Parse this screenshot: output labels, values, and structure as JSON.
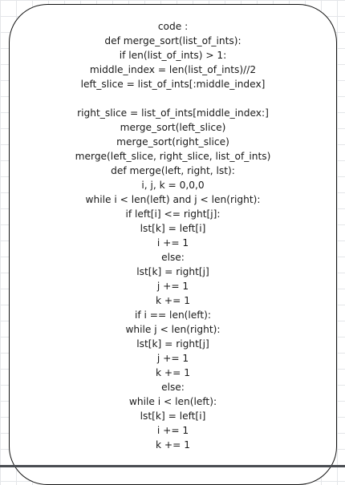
{
  "code_block": {
    "lines": [
      "code :",
      "def merge_sort(list_of_ints):",
      "if len(list_of_ints) > 1:",
      "middle_index = len(list_of_ints)//2",
      "left_slice = list_of_ints[:middle_index]",
      "",
      "right_slice = list_of_ints[middle_index:]",
      "merge_sort(left_slice)",
      "merge_sort(right_slice)",
      "merge(left_slice, right_slice, list_of_ints)",
      "def merge(left, right, lst):",
      "i, j, k = 0,0,0",
      "while i < len(left) and j < len(right):",
      "if left[i] <= right[j]:",
      "lst[k] = left[i]",
      "i += 1",
      "else:",
      "lst[k] = right[j]",
      "j += 1",
      "k += 1",
      "if i == len(left):",
      "while j < len(right):",
      "lst[k] = right[j]",
      "j += 1",
      "k += 1",
      "else:",
      "while i < len(left):",
      "lst[k] = left[i]",
      "i += 1",
      "k += 1"
    ]
  }
}
